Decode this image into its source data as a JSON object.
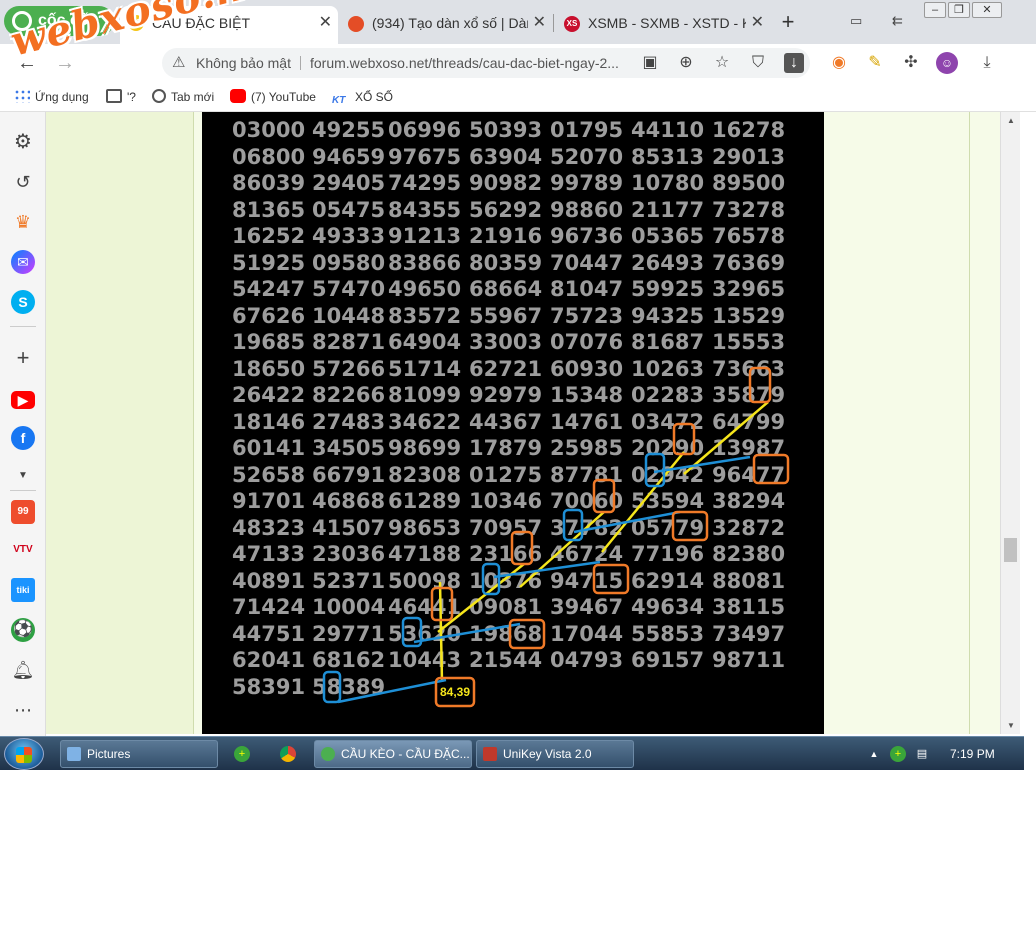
{
  "watermark": "webxoso.net",
  "browser": {
    "logo": "cốc cốc",
    "tabs": [
      {
        "title": "CẦU ĐẶC BIỆT",
        "favicon_color": "#f5c518",
        "favicon_text": "XS"
      },
      {
        "title": "(934) Tạo dàn xổ số | Dàn",
        "favicon_color": "#e44d26"
      },
      {
        "title": "XSMB - SXMB - XSTD - K",
        "favicon_color": "#c8102e",
        "favicon_text": "XS"
      }
    ],
    "tab_close_glyph": "✕",
    "new_tab_glyph": "+",
    "address": {
      "security_label": "Không bảo mật",
      "url": "forum.webxoso.net/threads/cau-dac-biet-ngay-2..."
    },
    "bookmarks": [
      {
        "label": "Ứng dụng"
      },
      {
        "label": "'?"
      },
      {
        "label": "Tab mới"
      },
      {
        "label": "(7) YouTube"
      },
      {
        "label": "XỔ SỐ"
      }
    ]
  },
  "grid": {
    "rows": [
      [
        "03000",
        "49255",
        "06996",
        "50393",
        "01795",
        "44110",
        "16278"
      ],
      [
        "06800",
        "94659",
        "97675",
        "63904",
        "52070",
        "85313",
        "29013"
      ],
      [
        "86039",
        "29405",
        "74295",
        "90982",
        "99789",
        "10780",
        "89500"
      ],
      [
        "81365",
        "05475",
        "84355",
        "56292",
        "98860",
        "21177",
        "73278"
      ],
      [
        "16252",
        "49333",
        "91213",
        "21916",
        "96736",
        "05365",
        "76578"
      ],
      [
        "51925",
        "09580",
        "83866",
        "80359",
        "70447",
        "26493",
        "76369"
      ],
      [
        "54247",
        "57470",
        "49650",
        "68664",
        "81047",
        "59925",
        "32965"
      ],
      [
        "67626",
        "10448",
        "83572",
        "55967",
        "75723",
        "94325",
        "13529"
      ],
      [
        "19685",
        "82871",
        "64904",
        "33003",
        "07076",
        "81687",
        "15553"
      ],
      [
        "18650",
        "57266",
        "51714",
        "62721",
        "60930",
        "10263",
        "73663"
      ],
      [
        "26422",
        "82266",
        "81099",
        "92979",
        "15348",
        "02283",
        "35879"
      ],
      [
        "18146",
        "27483",
        "34622",
        "44367",
        "14761",
        "03472",
        "64799"
      ],
      [
        "60141",
        "34505",
        "98699",
        "17879",
        "25985",
        "20290",
        "13987"
      ],
      [
        "52658",
        "66791",
        "82308",
        "01275",
        "87781",
        "02942",
        "96477"
      ],
      [
        "91701",
        "46868",
        "61289",
        "10346",
        "70060",
        "53594",
        "38294"
      ],
      [
        "48323",
        "41507",
        "98653",
        "70957",
        "37782",
        "05779",
        "32872"
      ],
      [
        "47133",
        "23036",
        "47188",
        "23166",
        "46724",
        "77196",
        "82380"
      ],
      [
        "40891",
        "52371",
        "50098",
        "10376",
        "94715",
        "62914",
        "88081"
      ],
      [
        "71424",
        "10004",
        "46441",
        "09081",
        "39467",
        "49634",
        "38115"
      ],
      [
        "44751",
        "29771",
        "53620",
        "19868",
        "17044",
        "55853",
        "73497"
      ],
      [
        "62041",
        "68162",
        "10443",
        "21544",
        "04793",
        "69157",
        "98711"
      ],
      [
        "58391",
        "58389"
      ]
    ],
    "result_label": "84,39",
    "colors": {
      "panel": "#000000",
      "digits": "#9d9d9d",
      "orange": "#f07a28",
      "blue": "#1e8fd6",
      "yellow": "#f5e51b"
    }
  },
  "taskbar": {
    "items": [
      {
        "label": "Pictures"
      },
      {
        "label": "CẦU KÈO - CẦU ĐẶC..."
      },
      {
        "label": "UniKey Vista 2.0"
      }
    ],
    "clock": "7:19 PM"
  }
}
